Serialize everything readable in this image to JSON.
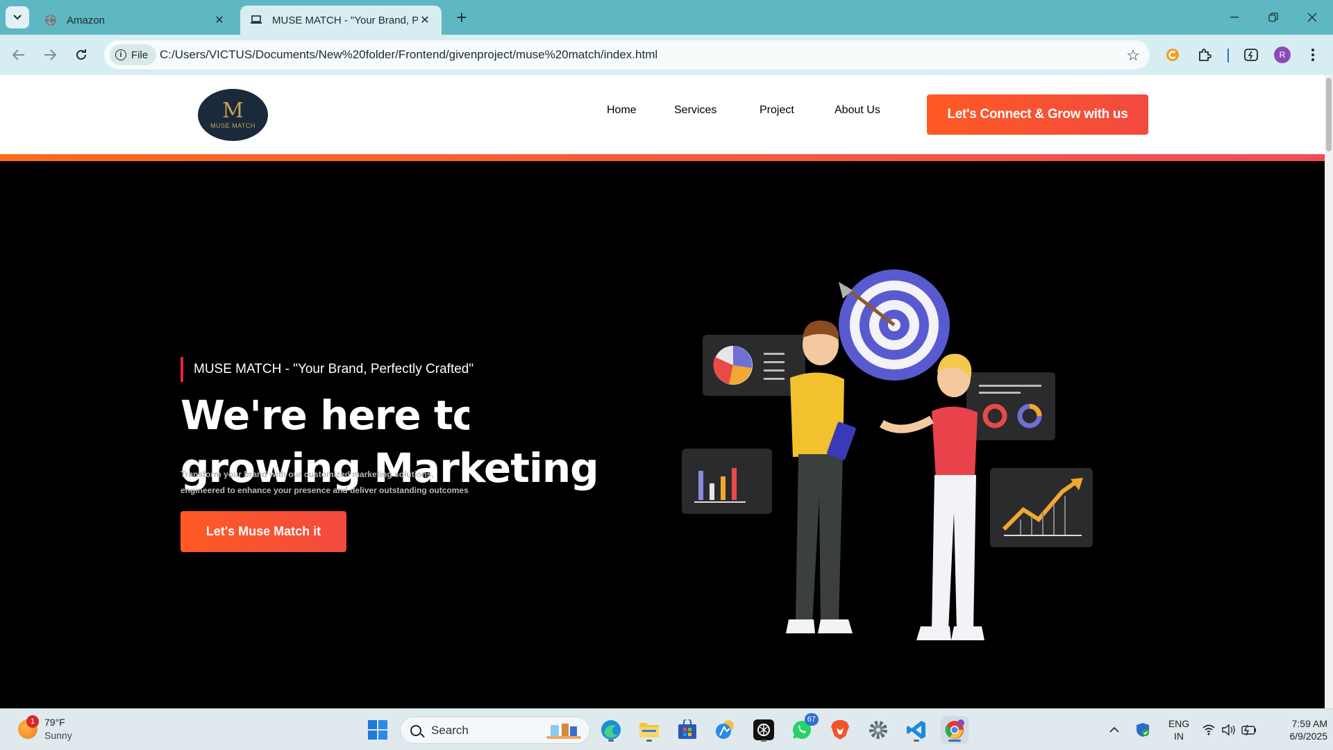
{
  "browser": {
    "tabs": [
      {
        "title": "Amazon",
        "active": false
      },
      {
        "title": "MUSE MATCH - \"Your Brand, Pe",
        "active": true
      }
    ],
    "url_scheme_chip": "File",
    "url": "C:/Users/VICTUS/Documents/New%20folder/Frontend/givenproject/muse%20match/index.html",
    "profile_initial": "R"
  },
  "site": {
    "logo_text": "MUSE MATCH",
    "nav": [
      "Home",
      "Services",
      "Project",
      "About Us"
    ],
    "header_cta": "Let's Connect & Grow with us",
    "hero": {
      "tagline": "MUSE MATCH - \"Your Brand, Perfectly Crafted\"",
      "headline_line1": "We're here to w",
      "headline_line2": "growing Marketing",
      "description_line1": "Transform your brand with our customized marketing solutions,",
      "description_line2": "engineered to enhance your presence and deliver outstanding outcomes",
      "cta": "Let's Muse Match it"
    }
  },
  "taskbar": {
    "weather_temp": "79°F",
    "weather_condition": "Sunny",
    "weather_badge": "1",
    "search_placeholder": "Search",
    "whatsapp_badge": "67",
    "language_line1": "ENG",
    "language_line2": "IN",
    "time": "7:59 AM",
    "date": "6/9/2025"
  },
  "colors": {
    "chrome_tabstrip": "#5eb7c2",
    "chrome_toolbar": "#d6eef1",
    "accent_orange": "#ff5a24",
    "accent_red": "#e8213b"
  }
}
